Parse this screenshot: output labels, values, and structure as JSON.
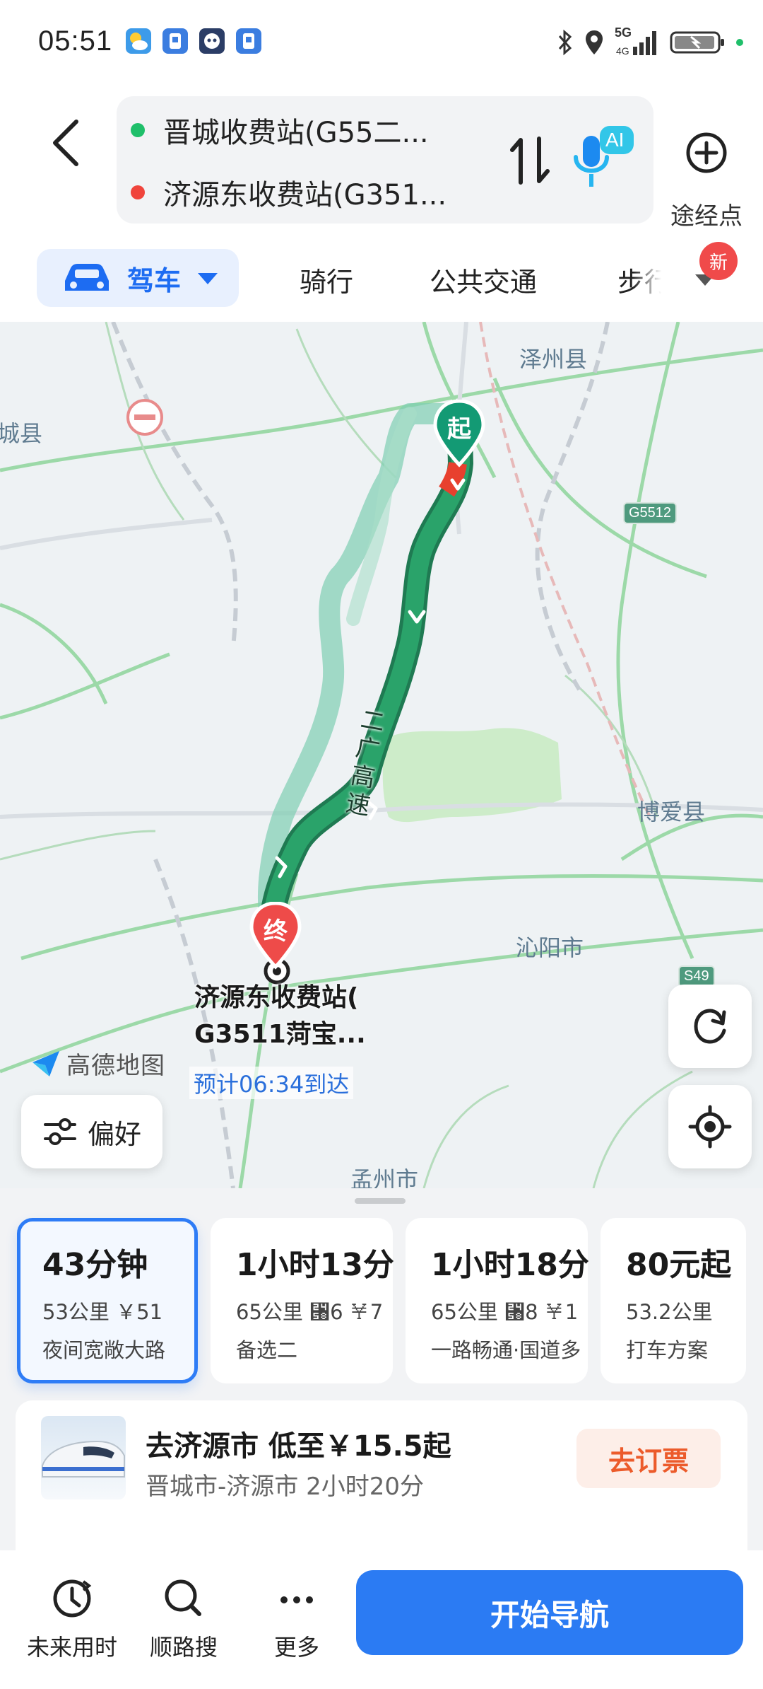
{
  "status_bar": {
    "time": "05:51",
    "network": "5G",
    "icons": [
      "weather-icon",
      "app-icon",
      "app-icon",
      "app-icon",
      "bluetooth-icon",
      "location-icon",
      "signal-icon",
      "battery-icon"
    ]
  },
  "header": {
    "start": "晋城收费站(G55二...",
    "end": "济源东收费站(G351...",
    "ai_badge": "AI",
    "via_label": "途经点",
    "start_color": "#1fbf6a",
    "end_color": "#f0443c"
  },
  "modes": {
    "drive": "驾车",
    "ride": "骑行",
    "transit": "公共交通",
    "walk": "步行",
    "new_badge": "新"
  },
  "map": {
    "labels": {
      "zezhou": "泽州县",
      "cheng": "城县",
      "boai": "博爱县",
      "qinyang": "沁阳市",
      "mengzhou": "孟州市",
      "road_name": "二广高速"
    },
    "badges": {
      "g5512": "G5512",
      "s49": "S49"
    },
    "start_marker": "起",
    "end_marker": "终",
    "dest_name_line1": "济源东收费站(",
    "dest_name_line2": "G3511菏宝...",
    "eta": "预计06:34到达",
    "brand": "高德地图",
    "pref_label": "偏好"
  },
  "routes": [
    {
      "time": "43分钟",
      "meta": "53公里 ￥51",
      "tag": "夜间宽敞大路",
      "active": true
    },
    {
      "time": "1小时13分",
      "meta": "65公里 ⑘6 ￥7",
      "tag": "备选二",
      "active": false
    },
    {
      "time": "1小时18分",
      "meta": "65公里 ⑘8 ￥1",
      "tag": "一路畅通·国道多",
      "active": false
    },
    {
      "time": "80元起",
      "meta": "53.2公里",
      "tag": "打车方案",
      "active": false
    }
  ],
  "train": {
    "title": "去济源市 低至￥15.5起",
    "sub": "晋城市-济源市 2小时20分",
    "button": "去订票"
  },
  "bottom_bar": {
    "future": "未来用时",
    "along": "顺路搜",
    "more": "更多",
    "navigate": "开始导航"
  }
}
